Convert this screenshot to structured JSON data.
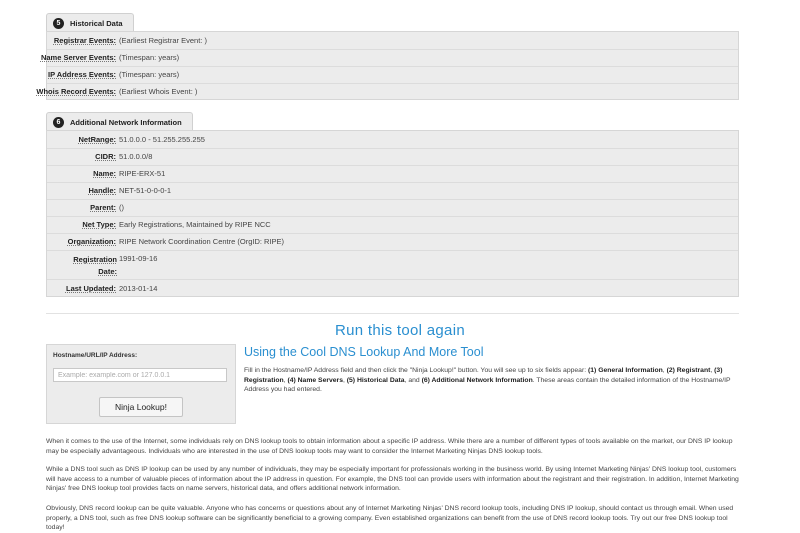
{
  "historical": {
    "number": "5",
    "title": "Historical Data",
    "rows": [
      {
        "label": "Registrar Events",
        "value": "(Earliest Registrar Event: )"
      },
      {
        "label": "Name Server Events",
        "value": "(Timespan: years)"
      },
      {
        "label": "IP Address Events",
        "value": "(Timespan: years)"
      },
      {
        "label": "Whois Record Events",
        "value": "(Earliest Whois Event: )"
      }
    ]
  },
  "network": {
    "number": "6",
    "title": "Additional Network Information",
    "rows": [
      {
        "label": "NetRange",
        "value": "51.0.0.0 - 51.255.255.255"
      },
      {
        "label": "CIDR",
        "value": "51.0.0.0/8"
      },
      {
        "label": "Name",
        "value": "RIPE-ERX-51"
      },
      {
        "label": "Handle",
        "value": "NET-51-0-0-0-1"
      },
      {
        "label": "Parent",
        "value": "()"
      },
      {
        "label": "Net Type",
        "value": "Early Registrations, Maintained by RIPE NCC"
      },
      {
        "label": "Organization",
        "value": "RIPE Network Coordination Centre (OrgID: RIPE)"
      },
      {
        "label": "Registration Date",
        "label_line1": "Registration",
        "label_line2": "Date",
        "value": "1991-09-16"
      },
      {
        "label": "Last Updated",
        "value": "2013-01-14"
      }
    ]
  },
  "run_again_title": "Run this tool again",
  "tool": {
    "field_label": "Hostname/URL/IP Address:",
    "placeholder": "Example: example.com or 127.0.0.1",
    "value": "",
    "button_label": "Ninja Lookup!"
  },
  "subtitle": "Using the Cool DNS Lookup And More Tool",
  "description": {
    "intro": "Fill in the Hostname/IP Address field and then click the \"Ninja Lookup!\" button. You will see up to six fields appear: ",
    "items": [
      "(1) General Information",
      "(2) Registrant",
      "(3) Registration",
      "(4) Name Servers",
      "(5) Historical Data",
      "(6) Additional Network Information"
    ],
    "outro": ". These areas contain the detailed information of the Hostname/IP Address you had entered."
  },
  "paragraphs": [
    "When it comes to the use of the Internet, some individuals rely on DNS lookup tools to obtain information about a specific IP address. While there are a number of different types of tools available on the market, our DNS IP lookup may be especially advantageous. Individuals who are interested in the use of DNS lookup tools may want to consider the Internet Marketing Ninjas DNS lookup tools.",
    "While a DNS tool such as DNS IP lookup can be used by any number of individuals, they may be especially important for professionals working in the business world. By using Internet Marketing Ninjas' DNS lookup tool, customers will have access to a number of valuable pieces of information about the IP address in question. For example, the DNS tool can provide users with information about the registrant and their registration. In addition, Internet Marketing Ninjas' free DNS lookup tool provides facts on name servers, historical data, and offers additional network information.",
    "Obviously, DNS record lookup can be quite valuable. Anyone who has concerns or questions about any of Internet Marketing Ninjas' DNS record lookup tools, including DNS IP lookup, should contact us through email. When used properly, a DNS tool, such as free DNS lookup software can be significantly beneficial to a growing company. Even established organizations can benefit from the use of DNS record lookup tools. Try out our free DNS lookup tool today!"
  ]
}
